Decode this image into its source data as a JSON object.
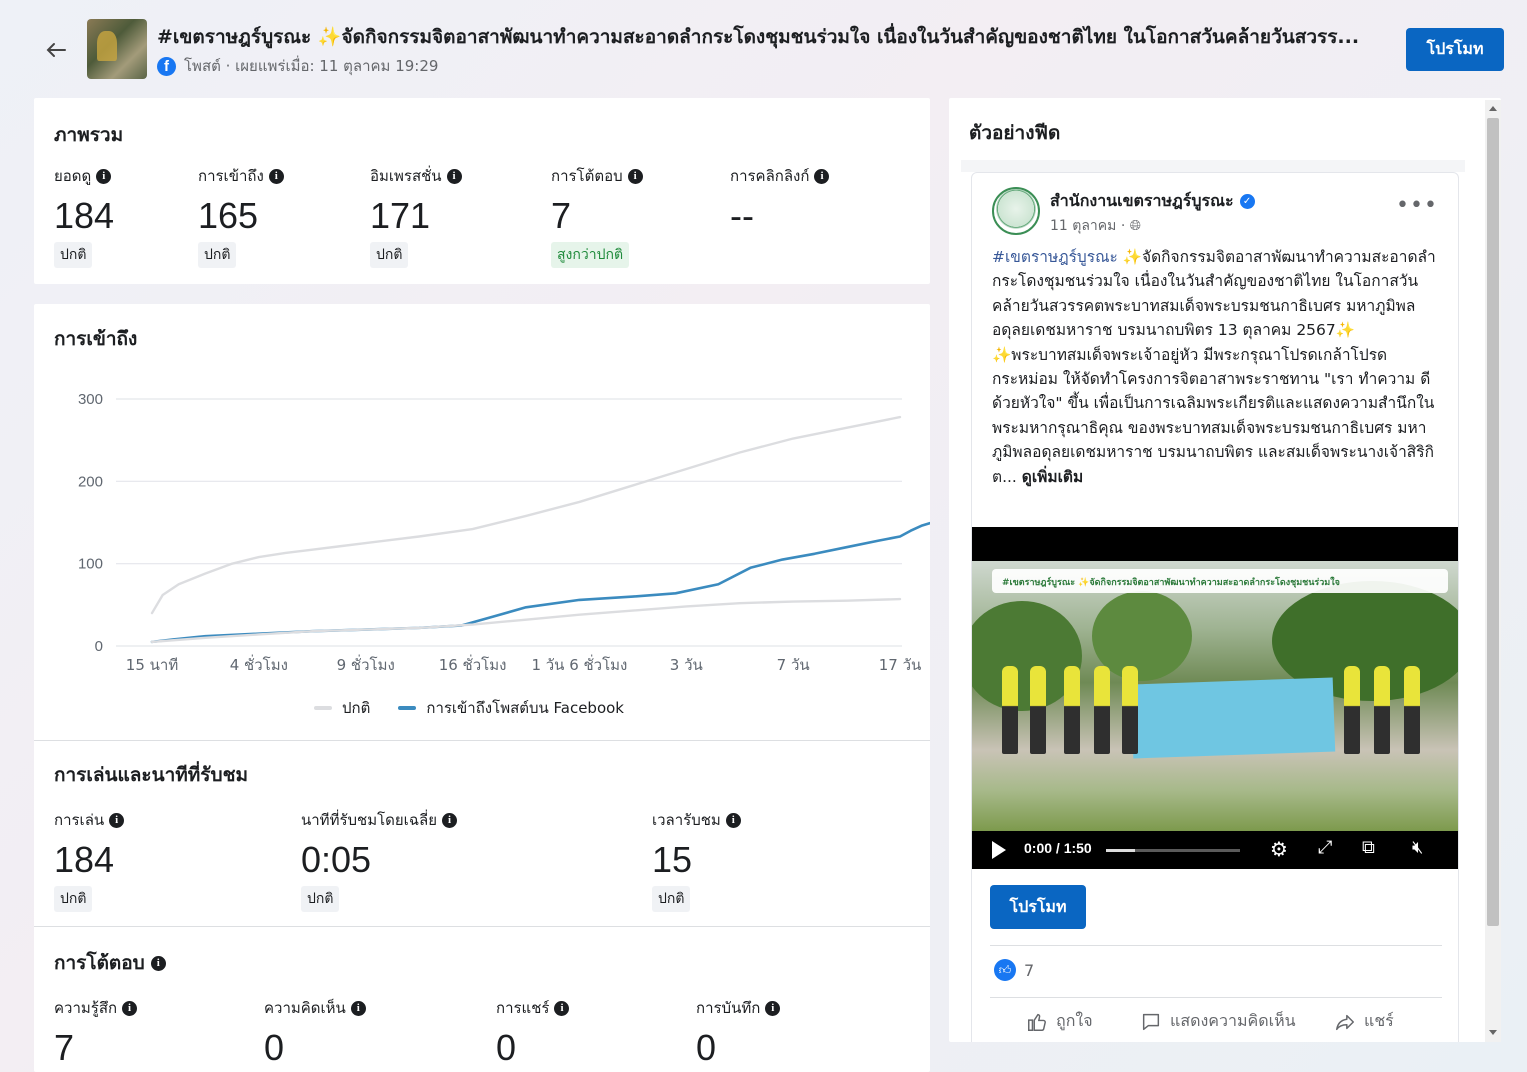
{
  "header": {
    "title": "#เขตราษฎร์บูรณะ ✨จัดกิจกรรมจิตอาสาพัฒนาทำความสะอาดลำกระโดงชุมชนร่วมใจ เนื่องในวันสำคัญของชาติไทย ในโอกาสวันคล้ายวันสวรร...",
    "meta": "โพสต์ · เผยแพร่เมื่อ: 11 ตุลาคม 19:29",
    "promote_label": "โปรโมท"
  },
  "overview": {
    "title": "ภาพรวม",
    "metrics": [
      {
        "label": "ยอดดู",
        "value": "184",
        "badge": "ปกติ"
      },
      {
        "label": "การเข้าถึง",
        "value": "165",
        "badge": "ปกติ"
      },
      {
        "label": "อิมเพรสชั่น",
        "value": "171",
        "badge": "ปกติ"
      },
      {
        "label": "การโต้ตอบ",
        "value": "7",
        "badge": "สูงกว่าปกติ"
      },
      {
        "label": "การคลิกลิงก์",
        "value": "--",
        "badge": ""
      }
    ]
  },
  "reach": {
    "title": "การเข้าถึง"
  },
  "chart_data": {
    "type": "line",
    "title": "",
    "xlabel": "",
    "ylabel": "",
    "x_ticks": [
      "15 นาที",
      "4 ชั่วโมง",
      "9 ชั่วโมง",
      "16 ชั่วโมง",
      "1 วัน 6 ชั่วโมง",
      "3 วัน",
      "7 วัน",
      "17 วัน"
    ],
    "y_ticks": [
      0,
      100,
      200,
      300
    ],
    "ylim": [
      0,
      300
    ],
    "grid": true,
    "legend_position": "bottom",
    "series": [
      {
        "name": "ปกติ",
        "color": "#dcdde0",
        "x": [
          0,
          0.1,
          0.25,
          0.5,
          0.75,
          1,
          1.25,
          1.5,
          1.75,
          2,
          2.5,
          3,
          3.5,
          4,
          4.5,
          5,
          5.5,
          6,
          6.5,
          7
        ],
        "values": [
          40,
          62,
          75,
          88,
          100,
          108,
          113,
          117,
          121,
          125,
          133,
          142,
          158,
          175,
          195,
          215,
          235,
          252,
          265,
          278
        ]
      },
      {
        "name": "การเข้าถึงโพสต์บน Facebook",
        "color": "#3b8bbf",
        "x": [
          0,
          0.2,
          0.5,
          1,
          1.5,
          2,
          2.5,
          2.9,
          3.2,
          3.5,
          4,
          4.5,
          4.9,
          5.3,
          5.6,
          5.9,
          6.2,
          6.5,
          6.8,
          7,
          7.1,
          7.2,
          7.5
        ],
        "values": [
          5,
          8,
          12,
          15,
          18,
          20,
          22,
          25,
          36,
          47,
          56,
          60,
          64,
          75,
          95,
          105,
          112,
          120,
          128,
          133,
          140,
          146,
          158
        ]
      },
      {
        "name": "ปกติ (ล่าง)",
        "color": "#dcdde0",
        "x": [
          0,
          0.5,
          1,
          1.5,
          2,
          2.5,
          3,
          3.5,
          4,
          4.5,
          5,
          5.5,
          6,
          6.5,
          7
        ],
        "values": [
          5,
          10,
          14,
          18,
          20,
          22,
          26,
          32,
          38,
          43,
          48,
          52,
          54,
          55,
          57
        ]
      }
    ]
  },
  "legend": {
    "normal": "ปกติ",
    "reach": "การเข้าถึงโพสต์บน Facebook"
  },
  "plays": {
    "title": "การเล่นและนาทีที่รับชม",
    "metrics": [
      {
        "label": "การเล่น",
        "value": "184",
        "badge": "ปกติ"
      },
      {
        "label": "นาทีที่รับชมโดยเฉลี่ย",
        "value": "0:05",
        "badge": "ปกติ"
      },
      {
        "label": "เวลารับชม",
        "value": "15",
        "badge": "ปกติ"
      }
    ]
  },
  "interactions": {
    "title": "การโต้ตอบ",
    "metrics": [
      {
        "label": "ความรู้สึก",
        "value": "7"
      },
      {
        "label": "ความคิดเห็น",
        "value": "0"
      },
      {
        "label": "การแชร์",
        "value": "0"
      },
      {
        "label": "การบันทึก",
        "value": "0"
      }
    ]
  },
  "feed": {
    "title": "ตัวอย่างฟีด",
    "page_name": "สำนักงานเขตราษฎร์บูรณะ",
    "date": "11 ตุลาคม ·",
    "hashtag": "#เขตราษฎร์บูรณะ",
    "text_1": " ✨จัดกิจกรรมจิตอาสาพัฒนาทำความสะอาดลำกระโดงชุมชนร่วมใจ เนื่องในวันสำคัญของชาติไทย ในโอกาสวันคล้ายวันสวรรคตพระบาทสมเด็จพระบรมชนกาธิเบศร มหาภูมิพลอดุลยเดชมหาราช บรมนาถบพิตร 13 ตุลาคม 2567✨",
    "text_2": "✨พระบาทสมเด็จพระเจ้าอยู่หัว มีพระกรุณาโปรดเกล้าโปรดกระหม่อม ให้จัดทำโครงการจิตอาสาพระราชทาน \"เรา ทำความ ดี ด้วยหัวใจ\" ขึ้น เพื่อเป็นการเฉลิมพระเกียรติและแสดงความสำนึกในพระมหากรุณาธิคุณ ของพระบาทสมเด็จพระบรมชนกาธิเบศร มหาภูมิพลอดุลยเดชมหาราช บรมนาถบพิตร และสมเด็จพระนางเจ้าสิริกิต...",
    "see_more": "ดูเพิ่มเติม",
    "video_caption": "#เขตราษฎร์บูรณะ ✨จัดกิจกรรมจิตอาสาพัฒนาทำความสะอาดลำกระโดงชุมชนร่วมใจ",
    "video_time": "0:00 / 1:50",
    "video_progress": 0.22,
    "promote_label": "โปรโมท",
    "like_count": "7",
    "actions": {
      "like": "ถูกใจ",
      "comment": "แสดงความคิดเห็น",
      "share": "แชร์"
    }
  },
  "colors": {
    "primary": "#0a66c2",
    "reach_line": "#3b8bbf",
    "normal_line": "#dcdde0",
    "above_normal_badge": "#1f8a3b"
  }
}
